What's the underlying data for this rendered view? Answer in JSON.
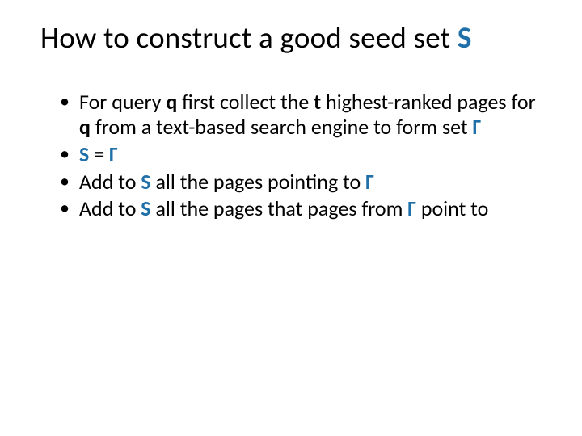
{
  "colors": {
    "accent": "#1f6fa8"
  },
  "title": {
    "t1": "How to construct a good seed set ",
    "S": "S"
  },
  "bullets": {
    "b1": {
      "t1": "For query ",
      "q1": "q",
      "t2": " first collect the ",
      "tvar": "t",
      "t3": " highest-ranked pages for ",
      "q2": "q",
      "t4": " from a text-based search engine to form set ",
      "gamma": "Γ"
    },
    "b2": {
      "S": "S",
      "eq": " = ",
      "gamma": "Γ"
    },
    "b3": {
      "t1": "Add to ",
      "S": "S",
      "t2": " all the pages pointing to ",
      "gamma": "Γ"
    },
    "b4": {
      "t1": "Add to ",
      "S": "S",
      "t2": " all the pages that pages from ",
      "gamma": "Γ",
      "t3": " point to"
    }
  }
}
